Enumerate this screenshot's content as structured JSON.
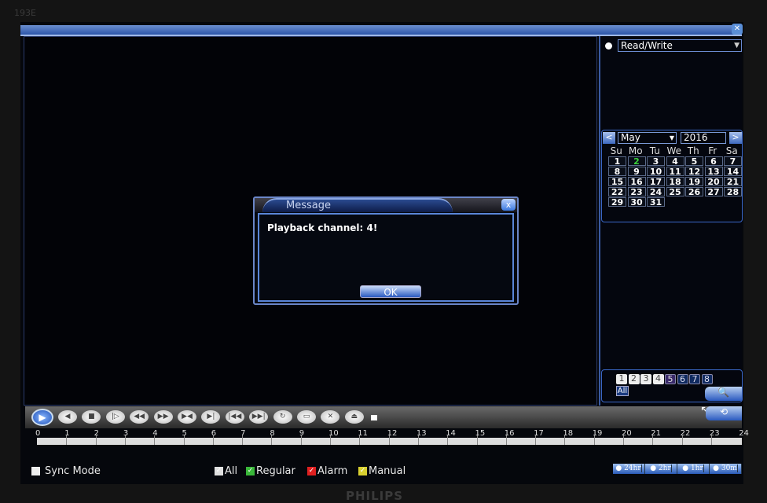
{
  "bezel_label": "193E",
  "brand_logo": "PHILIPS",
  "right_panel": {
    "mode_select": "Read/Write",
    "calendar": {
      "month": "May",
      "year": "2016",
      "weekdays": [
        "Su",
        "Mo",
        "Tu",
        "We",
        "Th",
        "Fr",
        "Sa"
      ],
      "days": [
        "1",
        "2",
        "3",
        "4",
        "5",
        "6",
        "7",
        "8",
        "9",
        "10",
        "11",
        "12",
        "13",
        "14",
        "15",
        "16",
        "17",
        "18",
        "19",
        "20",
        "21",
        "22",
        "23",
        "24",
        "25",
        "26",
        "27",
        "28",
        "29",
        "30",
        "31"
      ],
      "recorded_day": "2",
      "prev_icon": "<",
      "next_icon": ">"
    },
    "channels": [
      "1",
      "2",
      "3",
      "4",
      "5",
      "6",
      "7",
      "8"
    ],
    "all_label": "All",
    "search_icon": "magnifier-icon"
  },
  "dialog": {
    "title": "Message",
    "message": "Playback channel: 4!",
    "ok_label": "OK",
    "close_icon": "x"
  },
  "controls": [
    {
      "name": "play",
      "glyph": "▶"
    },
    {
      "name": "reverse-play",
      "glyph": "◀"
    },
    {
      "name": "stop",
      "glyph": "■"
    },
    {
      "name": "step-forward",
      "glyph": "|▷"
    },
    {
      "name": "slow",
      "glyph": "◀◀"
    },
    {
      "name": "fast",
      "glyph": "▶▶"
    },
    {
      "name": "prev-frame",
      "glyph": "▶◀"
    },
    {
      "name": "next-frame",
      "glyph": "▶|"
    },
    {
      "name": "prev-file",
      "glyph": "|◀◀"
    },
    {
      "name": "next-file",
      "glyph": "▶▶|"
    },
    {
      "name": "loop",
      "glyph": "↻"
    },
    {
      "name": "fullscreen",
      "glyph": "▭"
    },
    {
      "name": "close",
      "glyph": "✕"
    },
    {
      "name": "backup",
      "glyph": "⏏"
    }
  ],
  "timeline": {
    "hours": [
      "0",
      "1",
      "2",
      "3",
      "4",
      "5",
      "6",
      "7",
      "8",
      "9",
      "10",
      "11",
      "12",
      "13",
      "14",
      "15",
      "16",
      "17",
      "18",
      "19",
      "20",
      "21",
      "22",
      "23",
      "24"
    ]
  },
  "bottom": {
    "sync_mode": "Sync Mode",
    "filters": [
      {
        "label": "All",
        "color": "#e0e0e0"
      },
      {
        "label": "Regular",
        "color": "#3ab83a"
      },
      {
        "label": "Alarm",
        "color": "#e02020"
      },
      {
        "label": "Manual",
        "color": "#d8d030"
      }
    ],
    "zoom_options": [
      "24hr",
      "2hr",
      "1hr",
      "30m"
    ]
  }
}
